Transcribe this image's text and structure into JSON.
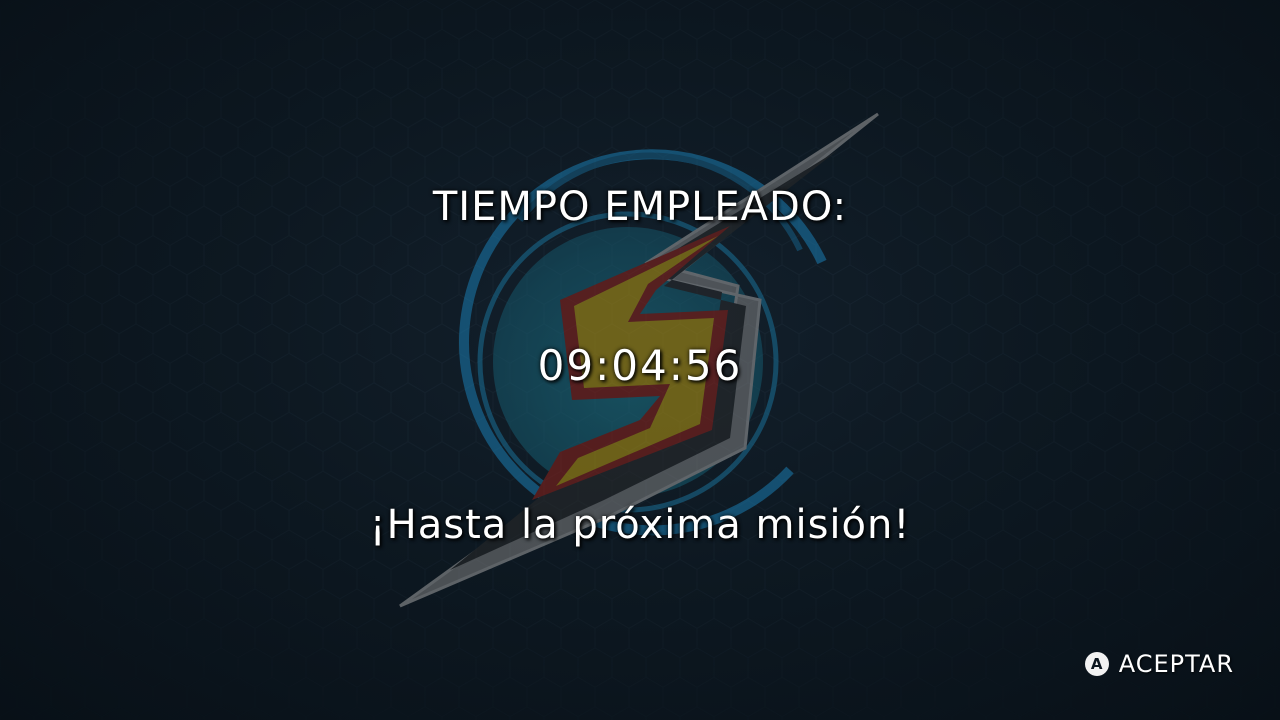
{
  "results": {
    "title": "TIEMPO EMPLEADO:",
    "time": "09:04:56",
    "farewell": "¡Hasta la próxima misión!"
  },
  "controls": {
    "accept_button_glyph": "A",
    "accept_label": "ACEPTAR"
  },
  "emblem": {
    "icon": "screw-attack-emblem-icon",
    "colors": {
      "ring": "#1f8fc4",
      "disc": "#1b6f86",
      "bolt_fill": "#c9a914",
      "bolt_border": "#a1281f",
      "bolt_outline": "#8c8c8c"
    }
  }
}
